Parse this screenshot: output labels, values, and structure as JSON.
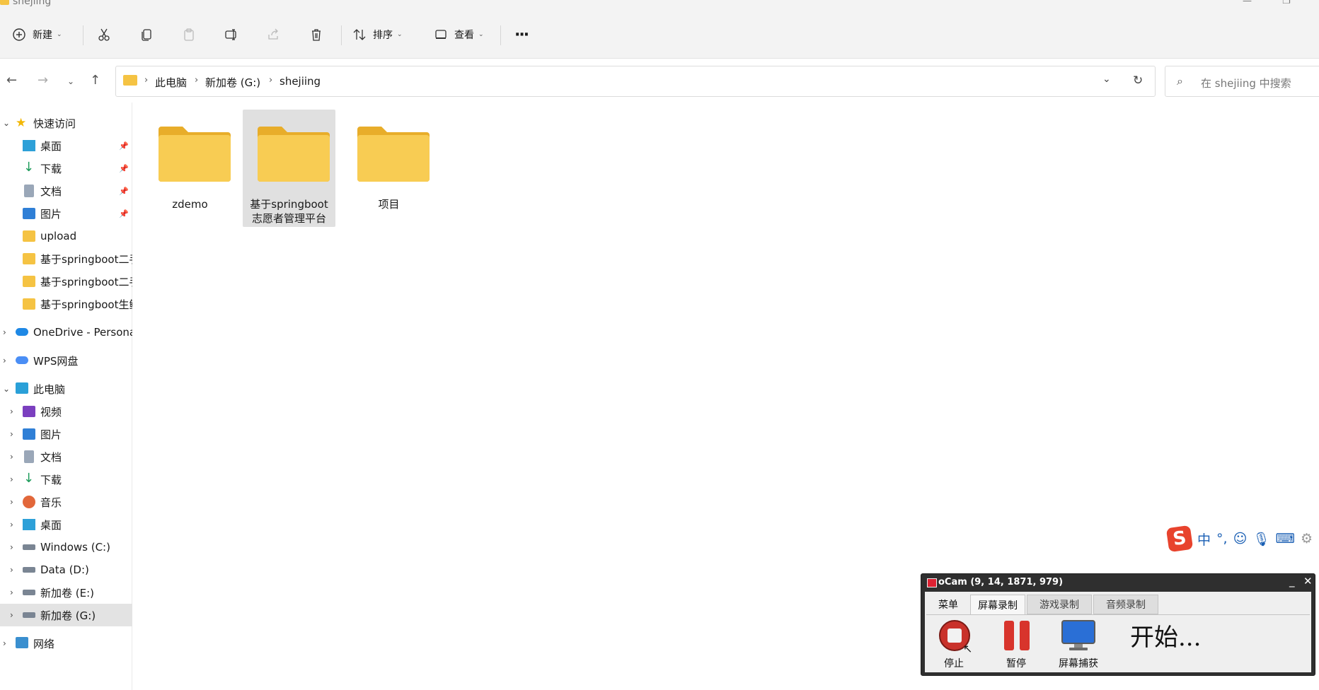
{
  "window": {
    "title": "shejiing",
    "minimize_icon": "minimize-icon",
    "restore_icon": "restore-icon"
  },
  "toolbar": {
    "new_label": "新建",
    "sort_label": "排序",
    "view_label": "查看",
    "more_label": "···"
  },
  "address": {
    "crumbs": [
      "此电脑",
      "新加卷 (G:)",
      "shejiing"
    ],
    "search_placeholder": "在 shejiing 中搜索"
  },
  "sidebar": {
    "quick_access": "快速访问",
    "quick_items": [
      "桌面",
      "下载",
      "文档",
      "图片",
      "upload",
      "基于springboot二手",
      "基于springboot二手",
      "基于springboot生鲜"
    ],
    "onedrive": "OneDrive - Personal",
    "wps": "WPS网盘",
    "this_pc": "此电脑",
    "pc_items": [
      "视频",
      "图片",
      "文档",
      "下载",
      "音乐",
      "桌面",
      "Windows (C:)",
      "Data (D:)",
      "新加卷 (E:)",
      "新加卷 (G:)"
    ],
    "network": "网络"
  },
  "content": {
    "folders": [
      {
        "name_line1": "zdemo",
        "name_line2": ""
      },
      {
        "name_line1": "基于springboot",
        "name_line2": "志愿者管理平台"
      },
      {
        "name_line1": "项目",
        "name_line2": ""
      }
    ]
  },
  "ime": {
    "mode": "中",
    "punct": "°,"
  },
  "ocam": {
    "title": "oCam (9, 14, 1871, 979)",
    "tabs": [
      "菜单",
      "屏幕录制",
      "游戏录制",
      "音频录制"
    ],
    "stop_label": "停止",
    "pause_label": "暂停",
    "capture_label": "屏幕捕获",
    "status": "开始..."
  },
  "colors": {
    "folder": "#f5c343",
    "folder_dark": "#e8ad2a",
    "selection": "#e0e0e0",
    "ocam_frame": "#2f2f2f"
  }
}
